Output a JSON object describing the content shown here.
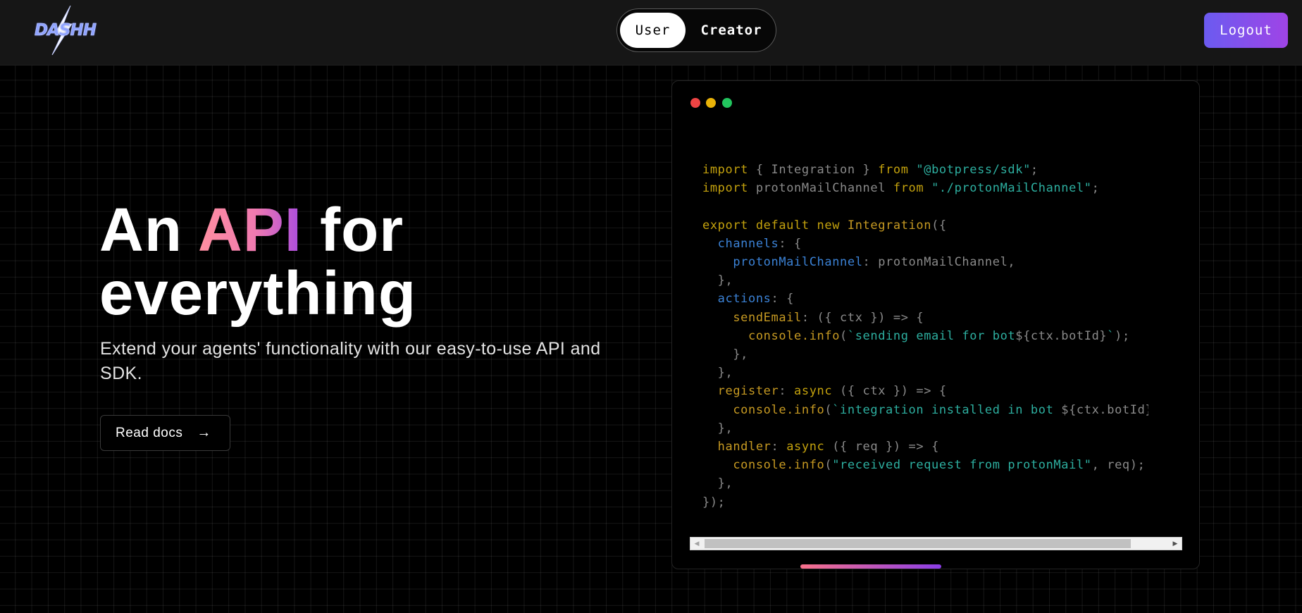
{
  "brand": {
    "logo_text": "DASHH"
  },
  "nav": {
    "toggle": {
      "user_label": "User",
      "creator_label": "Creator",
      "selected": "User"
    },
    "logout_label": "Logout"
  },
  "hero": {
    "title_prefix": "An ",
    "title_highlight": "API",
    "title_mid": " for",
    "title_line2": "everything",
    "subtitle": "Extend your agents' functionality with our easy-to-use API and SDK.",
    "cta_label": "Read docs",
    "cta_arrow": "→"
  },
  "code_window": {
    "traffic_lights": [
      "#ef4444",
      "#eab308",
      "#22c55e"
    ],
    "lines": [
      [
        [
          "kw",
          "import"
        ],
        [
          "pl",
          " { Integration } "
        ],
        [
          "kw",
          "from"
        ],
        [
          "str",
          " \"@botpress/sdk\""
        ],
        [
          "pl",
          ";"
        ]
      ],
      [
        [
          "kw",
          "import"
        ],
        [
          "pl",
          " protonMailChannel "
        ],
        [
          "kw",
          "from"
        ],
        [
          "str",
          " \"./protonMailChannel\""
        ],
        [
          "pl",
          ";"
        ]
      ],
      [],
      [
        [
          "kw",
          "export default new "
        ],
        [
          "fn",
          "Integration"
        ],
        [
          "pl",
          "({"
        ]
      ],
      [
        [
          "prop",
          "  channels"
        ],
        [
          "pl",
          ": {"
        ]
      ],
      [
        [
          "prop",
          "    protonMailChannel"
        ],
        [
          "pl",
          ": protonMailChannel,"
        ]
      ],
      [
        [
          "pl",
          "  },"
        ]
      ],
      [
        [
          "prop",
          "  actions"
        ],
        [
          "pl",
          ": {"
        ]
      ],
      [
        [
          "fn",
          "    sendEmail"
        ],
        [
          "pl",
          ": ({ ctx }) => {"
        ]
      ],
      [
        [
          "fn",
          "      console.info"
        ],
        [
          "pl",
          "("
        ],
        [
          "str",
          "`sending email for bot"
        ],
        [
          "pl",
          "${ctx.botId}"
        ],
        [
          "str",
          "`"
        ],
        [
          "pl",
          ");"
        ]
      ],
      [
        [
          "pl",
          "    },"
        ]
      ],
      [
        [
          "pl",
          "  },"
        ]
      ],
      [
        [
          "fn",
          "  register"
        ],
        [
          "pl",
          ": "
        ],
        [
          "kw",
          "async"
        ],
        [
          "pl",
          " ({ ctx }) => {"
        ]
      ],
      [
        [
          "fn",
          "    console.info"
        ],
        [
          "pl",
          "("
        ],
        [
          "str",
          "`integration installed in bot "
        ],
        [
          "pl",
          "${ctx.botId}"
        ],
        [
          "str",
          "`"
        ],
        [
          "pl",
          ");"
        ]
      ],
      [
        [
          "pl",
          "  },"
        ]
      ],
      [
        [
          "fn",
          "  handler"
        ],
        [
          "pl",
          ": "
        ],
        [
          "kw",
          "async"
        ],
        [
          "pl",
          " ({ req }) => {"
        ]
      ],
      [
        [
          "fn",
          "    console.info"
        ],
        [
          "pl",
          "("
        ],
        [
          "str",
          "\"received request from protonMail\""
        ],
        [
          "pl",
          ", req);"
        ]
      ],
      [
        [
          "pl",
          "  },"
        ]
      ],
      [
        [
          "pl",
          "});"
        ]
      ]
    ]
  }
}
